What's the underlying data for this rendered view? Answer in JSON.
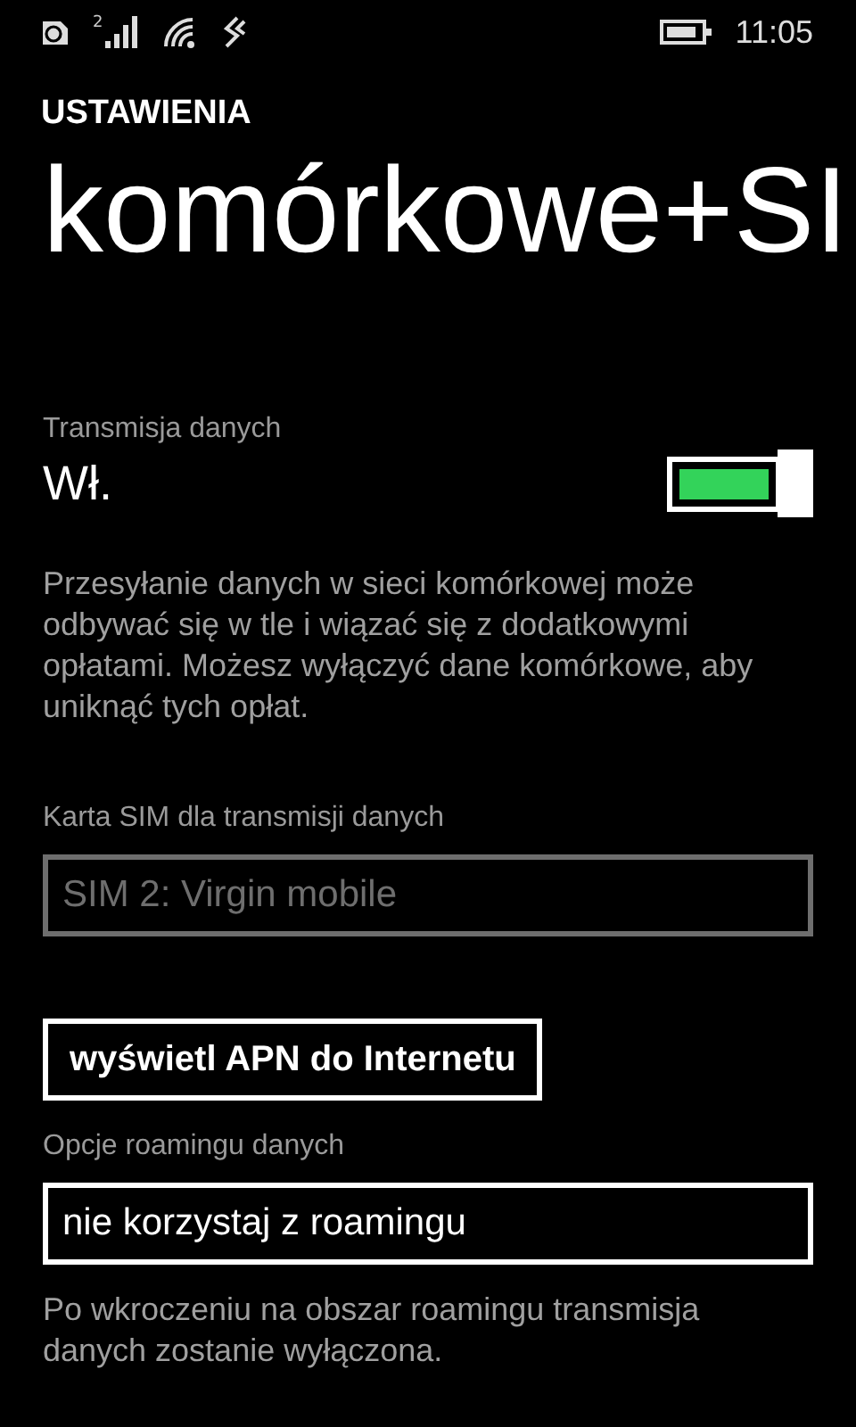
{
  "status_bar": {
    "sim_number": "2",
    "time": "11:05"
  },
  "header": {
    "app": "USTAWIENIA",
    "title": "komórkowe+SI"
  },
  "data_transmission": {
    "label": "Transmisja danych",
    "value": "Wł.",
    "on": true,
    "description": "Przesyłanie danych w sieci komórkowej może odbywać się w tle i wiązać się z dodatkowymi opłatami. Możesz wyłączyć dane komórkowe, aby uniknąć tych opłat."
  },
  "sim_select": {
    "label": "Karta SIM dla transmisji danych",
    "value": "SIM 2: Virgin mobile",
    "disabled": true
  },
  "apn_button": "wyświetl APN do Internetu",
  "roaming": {
    "label": "Opcje roamingu danych",
    "value": "nie korzystaj z roamingu",
    "disabled": false,
    "note": "Po wkroczeniu na obszar roamingu transmisja danych zostanie wyłączona."
  }
}
